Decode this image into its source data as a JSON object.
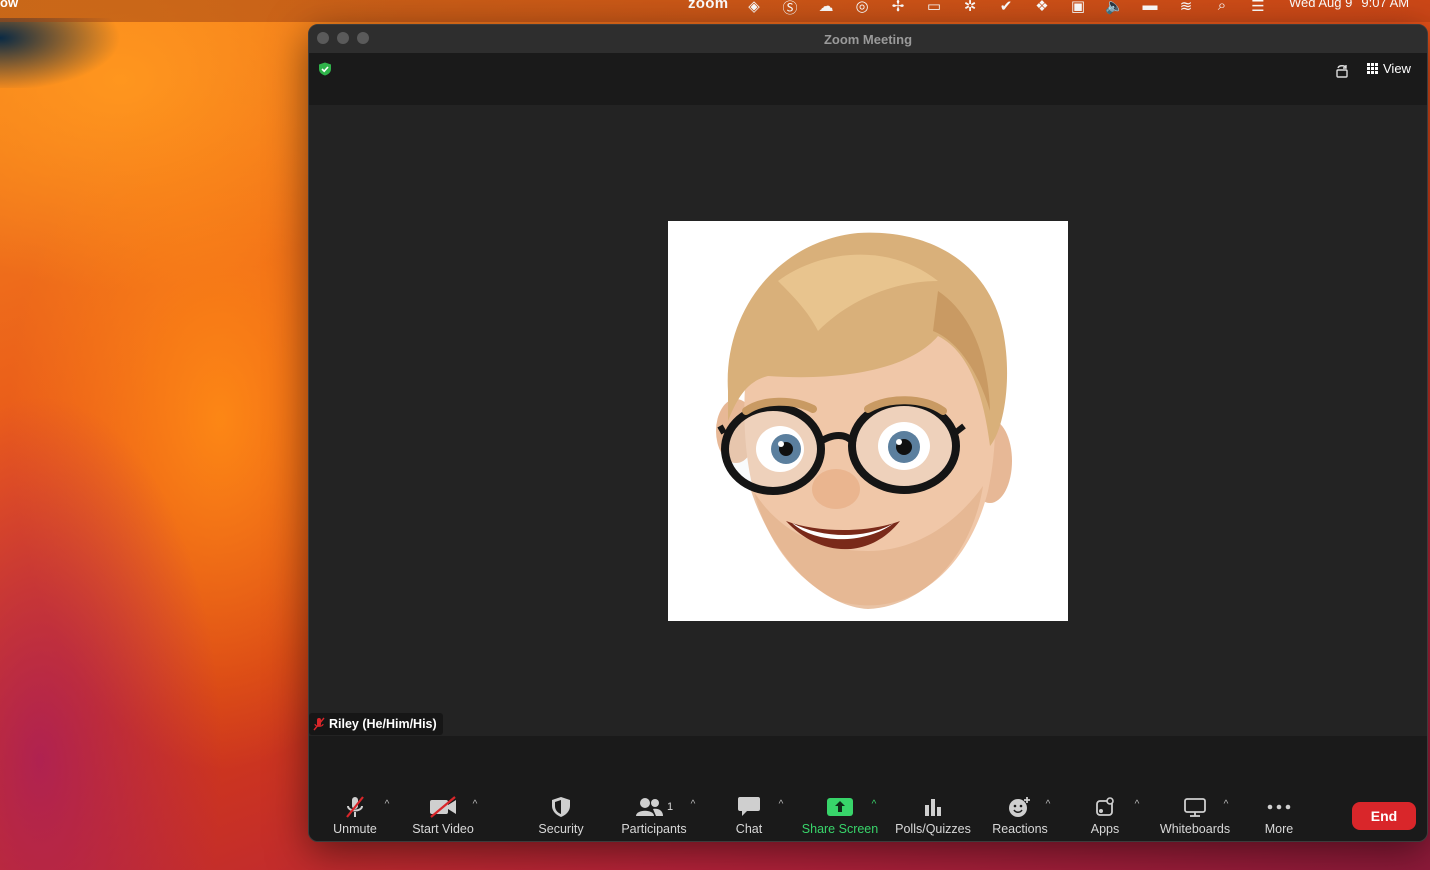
{
  "menubar": {
    "app_name": "ow",
    "zoom_brand": "zoom",
    "tray_icons": [
      "vpn-icon",
      "skype-icon",
      "creative-cloud-icon",
      "sync-icon",
      "fan-icon",
      "screen-icon",
      "gear-icon",
      "check-icon",
      "dropbox-icon",
      "display-icon",
      "volume-icon",
      "battery-icon",
      "wifi-icon",
      "search-icon",
      "control-center-icon"
    ],
    "date": "Wed Aug 9",
    "time": "9:07 AM"
  },
  "window": {
    "title": "Zoom Meeting",
    "view_label": "View"
  },
  "participant": {
    "name": "Riley (He/Him/His)",
    "muted": true
  },
  "toolbar": {
    "unmute": "Unmute",
    "start_video": "Start Video",
    "security": "Security",
    "participants": "Participants",
    "participant_count": "1",
    "chat": "Chat",
    "share_screen": "Share Screen",
    "polls": "Polls/Quizzes",
    "reactions": "Reactions",
    "apps": "Apps",
    "whiteboards": "Whiteboards",
    "more": "More",
    "end": "End"
  },
  "colors": {
    "share_green": "#38d46a",
    "end_red": "#d9262a",
    "shield_green": "#2fb34a"
  }
}
